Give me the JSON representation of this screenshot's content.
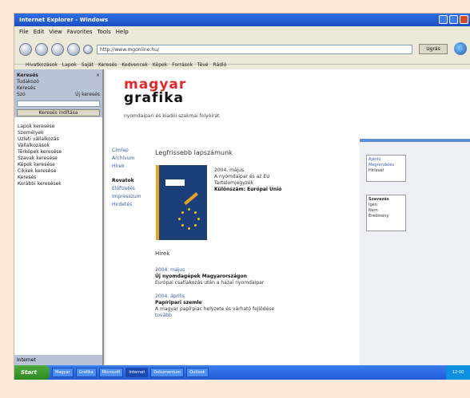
{
  "window": {
    "title": "Internet Explorer - Windows",
    "menu": [
      "File",
      "Edit",
      "View",
      "Favorites",
      "Tools",
      "Help"
    ],
    "address": "http://www.mgonline.hu/",
    "go_label": "Ugrás",
    "links": [
      "Hivatkozások",
      "Lapok",
      "Saját",
      "Keresés",
      "Kedvencek",
      "Képek",
      "Források",
      "Tévé",
      "Rádió"
    ]
  },
  "sidebar": {
    "title": "Keresés",
    "rows": [
      "Tudakozó",
      "Keresés",
      "Szó",
      "Új keresés"
    ],
    "search_button": "Keresés indítása",
    "items": [
      "Lapok keresése",
      "Személyek",
      "Üzleti vállalkozás",
      "Vállalkozások",
      "Térképek keresése",
      "Szavak keresése",
      "Képek keresése",
      "Cikkek keresése",
      "Keresés",
      "Korábbi keresések"
    ],
    "footer": "Internet"
  },
  "page": {
    "brand_line1": "magyar",
    "brand_line2": "grafika",
    "tagline": "nyomdaipari és kiadói szakmai folyóirat",
    "left_nav": [
      "Címlap",
      "Archívum",
      "Hírek",
      "Rovatok",
      "Előfizetés",
      "Impresszum",
      "Hirdetés"
    ],
    "heading": "Legfrissebb lapszámunk",
    "book": {
      "line1": "2004. május",
      "line2": "A nyomdaipar és az EU",
      "line3": "Tartalomjegyzék",
      "line4": "Különszám: Európai Unió"
    },
    "section": "Hírek",
    "articles": [
      {
        "date": "2004. május",
        "title": "Új nyomdagépek Magyarországon",
        "text": "Európai csatlakozás után a hazai nyomdaipar"
      },
      {
        "date": "2004. április",
        "title": "Papíripari szemle",
        "text": "A magyar papírpiac helyzete és várható fejlődése"
      }
    ],
    "more": "tovább"
  },
  "right": {
    "box1": [
      "Ajánló",
      "Megrendelés",
      "Hírlevél"
    ],
    "box2": [
      "Szavazás",
      "Igen",
      "Nem",
      "Eredmény"
    ]
  },
  "taskbar": {
    "start": "Start",
    "tasks": [
      "Magyar",
      "Grafika",
      "Microsoft",
      "Internet",
      "Dokumentum",
      "Outlook"
    ],
    "clock": "12:00"
  }
}
